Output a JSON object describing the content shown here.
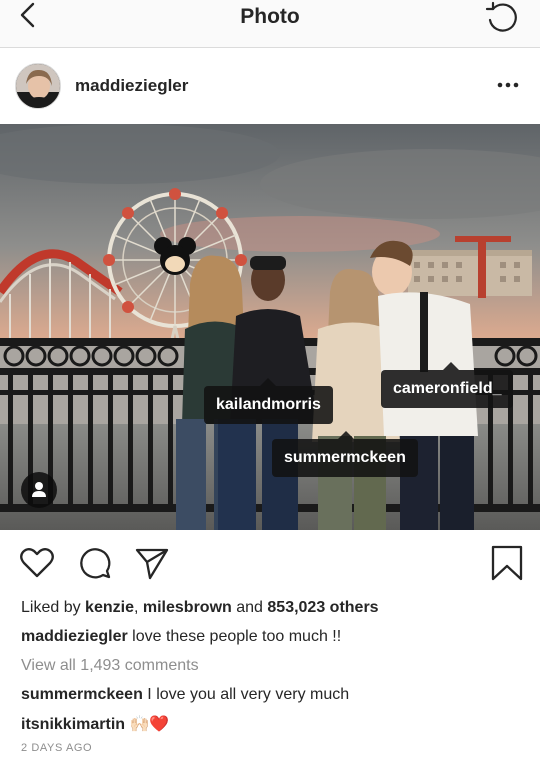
{
  "header": {
    "title": "Photo",
    "back_icon": "chevron-left-icon",
    "refresh_icon": "refresh-icon"
  },
  "post": {
    "username": "maddieziegler",
    "more_icon": "more-horizontal-icon",
    "photo_tags": [
      {
        "label": "cameronfield_"
      },
      {
        "label": "kailandmorris"
      },
      {
        "label": "summermckeen"
      }
    ],
    "action_icons": [
      "heart-icon",
      "comment-icon",
      "share-icon",
      "bookmark-icon"
    ],
    "likes": {
      "prefix": "Liked by",
      "user1": "kenzie",
      "sep": ",",
      "user2": "milesbrown",
      "and": "and",
      "others": "853,023 others"
    },
    "caption": {
      "user": "maddieziegler",
      "text": "love these people too much !!"
    },
    "view_comments": "View all 1,493 comments",
    "comments": [
      {
        "user": "summermckeen",
        "text": "I love you all very very much"
      },
      {
        "user": "itsnikkimartin",
        "text": "🙌🏻❤️"
      }
    ],
    "timestamp": "2 DAYS AGO"
  },
  "colors": {
    "text": "#262626",
    "muted": "#8e8e8e",
    "divider": "#dbdbdb",
    "tag_bg": "#121212"
  }
}
